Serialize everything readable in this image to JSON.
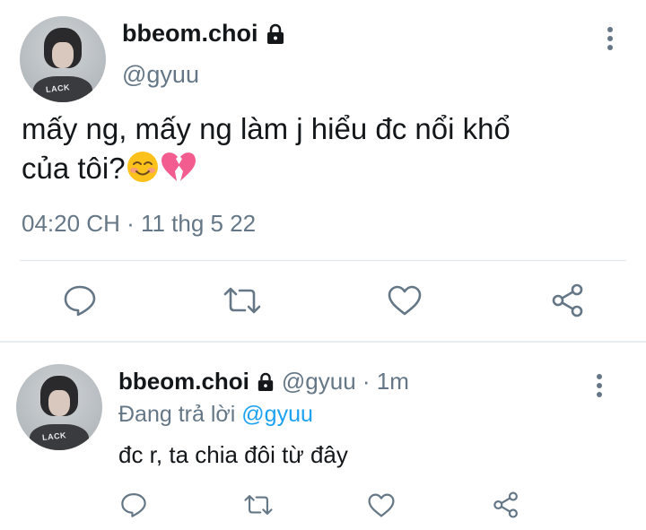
{
  "main_tweet": {
    "display_name": "bbeom.choi",
    "handle": "@gyuu",
    "text_line1": "mấy ng, mấy ng làm j hiểu đc nổi khổ",
    "text_line2": "của tôi?",
    "timestamp": "04:20 CH · 11 thg 5 22",
    "avatar_shirt_text": "LACK",
    "actions": [
      "reply-icon",
      "retweet-icon",
      "like-icon",
      "share-icon"
    ]
  },
  "reply_tweet": {
    "display_name": "bbeom.choi",
    "handle_meta": "@gyuu · 1m",
    "replying_prefix": "Đang trả lời ",
    "replying_to": "@gyuu",
    "text": "đc r, ta chia đôi từ đây",
    "avatar_shirt_text": "LACK",
    "actions": [
      "reply-icon",
      "retweet-icon",
      "like-icon",
      "share-icon"
    ]
  },
  "colors": {
    "text": "#14171a",
    "secondary": "#657786",
    "link": "#1da1f2",
    "divider": "#e1e8ed"
  },
  "icons": {
    "lock": "lock-icon",
    "more": "more-vertical-icon",
    "emoji_1": "smiling-face-emoji",
    "emoji_2": "broken-heart-emoji"
  }
}
